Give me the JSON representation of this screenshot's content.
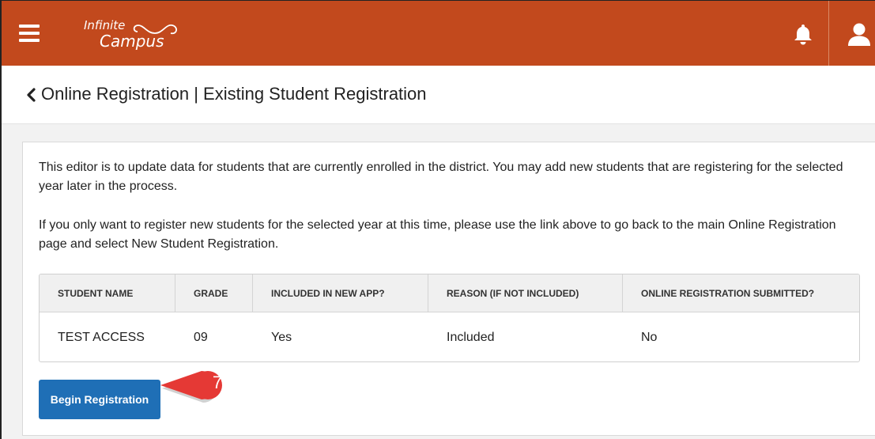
{
  "header": {
    "logo_line1": "Infinite",
    "logo_line2": "Campus",
    "icons": {
      "menu": "hamburger-menu-icon",
      "bell": "bell-icon",
      "user": "user-icon"
    },
    "brand_color": "#c2491d"
  },
  "page": {
    "title": "Online Registration | Existing Student Registration",
    "back_icon": "chevron-left-icon"
  },
  "intro": {
    "paragraph1": "This editor is to update data for students that are currently enrolled in the district. You may add new students that are registering for the selected year later in the process.",
    "paragraph2": "If you only want to register new students for the selected year at this time, please use the link above to go back to the main Online Registration page and select New Student Registration."
  },
  "table": {
    "headers": [
      "STUDENT NAME",
      "GRADE",
      "INCLUDED IN NEW APP?",
      "REASON (IF NOT INCLUDED)",
      "ONLINE REGISTRATION SUBMITTED?"
    ],
    "rows": [
      [
        "TEST ACCESS",
        "09",
        "Yes",
        "Included",
        "No"
      ]
    ]
  },
  "actions": {
    "begin_label": "Begin Registration",
    "button_color": "#1f6fb6"
  },
  "callout": {
    "number": "7",
    "color": "#e53935"
  }
}
